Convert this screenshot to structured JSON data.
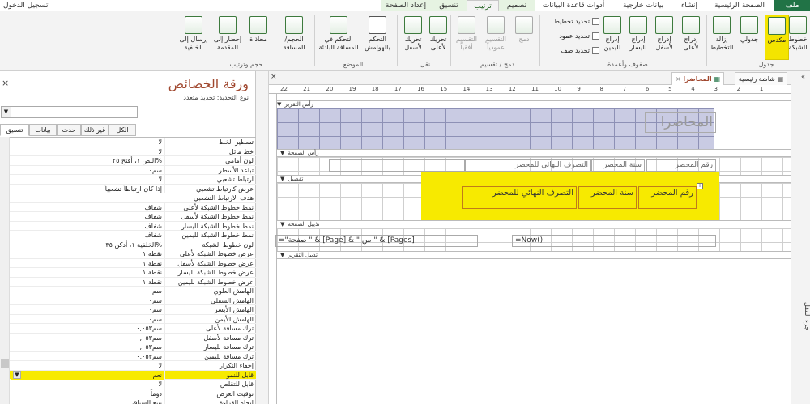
{
  "app": {
    "sign_in": "تسجيل الدخول"
  },
  "tabs": [
    {
      "label": "ملف",
      "kind": "file"
    },
    {
      "label": "الصفحة الرئيسية",
      "kind": "normal"
    },
    {
      "label": "إنشاء",
      "kind": "normal"
    },
    {
      "label": "بيانات خارجية",
      "kind": "normal"
    },
    {
      "label": "أدوات قاعدة البيانات",
      "kind": "normal"
    },
    {
      "label": "تصميم",
      "kind": "ctx"
    },
    {
      "label": "ترتيب",
      "kind": "active"
    },
    {
      "label": "تنسيق",
      "kind": "ctx"
    },
    {
      "label": "إعداد الصفحة",
      "kind": "ctx"
    }
  ],
  "ribbon": {
    "buttons": {
      "gridlines": "خطوط الشبكة",
      "stacked": "مكدس",
      "tabular": "جدولي",
      "remove_layout": "إزالة التخطيط",
      "insert_above": "إدراج لأعلى",
      "insert_below": "إدراج لأسفل",
      "insert_left": "إدراج لليسار",
      "insert_right": "إدراج لليمين",
      "merge": "دمج",
      "split_vertical": "التقسيم عمودياً",
      "split_horizontal": "التقسيم أفقياً",
      "move_up": "تحريك لأعلى",
      "move_down": "تحريك لأسفل",
      "control_margins": "التحكم بالهوامش",
      "control_padding": "التحكم في المسافة البادئة",
      "size_space": "الحجم/ المسافة",
      "align": "محاذاة",
      "bring_front": "إحضار إلى المقدمة",
      "send_back": "إرسال إلى الخلفية"
    },
    "small": {
      "select_layout": "تحديد تخطيط",
      "select_column": "تحديد عمود",
      "select_row": "تحديد صف"
    },
    "groups": {
      "table": "جدول",
      "rows_columns": "صفوف وأعمدة",
      "merge_split": "دمج / تقسيم",
      "move": "نقل",
      "position": "الموضع",
      "sizing_ordering": "حجم وترتيب"
    }
  },
  "properties": {
    "title": "ورقة الخصائص",
    "selection_type": "نوع التحديد:  تحديد متعدد",
    "close": "×",
    "tabs": [
      "الكل",
      "غير ذلك",
      "حدث",
      "بيانات",
      "تنسيق"
    ],
    "rows": [
      {
        "name": "تسطير الخط",
        "value": "لا"
      },
      {
        "name": "خط مائل",
        "value": "لا"
      },
      {
        "name": "لون أمامي",
        "value": "النص ۱، أفتح ۲٥%"
      },
      {
        "name": "تباعد الأسطر",
        "value": "۰سم"
      },
      {
        "name": "ارتباط تشعبي",
        "value": "لا"
      },
      {
        "name": "عرض كارتباط تشعبي",
        "value": "إذا كان ارتباطاً تشعبياً"
      },
      {
        "name": "هدف الارتباط التشعبي",
        "value": ""
      },
      {
        "name": "نمط خطوط الشبكة لأعلى",
        "value": "شفاف"
      },
      {
        "name": "نمط خطوط الشبكة لأسفل",
        "value": "شفاف"
      },
      {
        "name": "نمط خطوط الشبكة لليسار",
        "value": "شفاف"
      },
      {
        "name": "نمط خطوط الشبكة لليمين",
        "value": "شفاف"
      },
      {
        "name": "لون خطوط الشبكة",
        "value": "الخلفية ۱، أدكن ۳٥%"
      },
      {
        "name": "عرض خطوط الشبكة لأعلى",
        "value": "۱ نقطة"
      },
      {
        "name": "عرض خطوط الشبكة لأسفل",
        "value": "۱ نقطة"
      },
      {
        "name": "عرض خطوط الشبكة لليسار",
        "value": "۱ نقطة"
      },
      {
        "name": "عرض خطوط الشبكة لليمين",
        "value": "۱ نقطة"
      },
      {
        "name": "الهامش العلوي",
        "value": "۰سم"
      },
      {
        "name": "الهامش السفلي",
        "value": "۰سم"
      },
      {
        "name": "الهامش الأيسر",
        "value": "۰سم"
      },
      {
        "name": "الهامش الأيمن",
        "value": "۰سم"
      },
      {
        "name": "ترك مسافة لأعلى",
        "value": "۰,۰٥۳سم"
      },
      {
        "name": "ترك مسافة لأسفل",
        "value": "۰,۰٥۳سم"
      },
      {
        "name": "ترك مسافة لليسار",
        "value": "۰,۰٥۳سم"
      },
      {
        "name": "ترك مسافة لليمين",
        "value": "۰,۰٥۳سم"
      },
      {
        "name": "إخفاء التكرار",
        "value": "لا"
      },
      {
        "name": "قابل للنمو",
        "value": "نعم"
      },
      {
        "name": "قابل للتقلص",
        "value": "لا"
      },
      {
        "name": "توقيت العرض",
        "value": "دوماً"
      },
      {
        "name": "اتجاه القراءة",
        "value": "تتبع السياق"
      }
    ],
    "highlight_row": 25
  },
  "document": {
    "tabs": [
      {
        "label": "شاشة رئيسية",
        "active": false
      },
      {
        "label": "المحاضرا",
        "active": true
      }
    ],
    "ruler_numbers": [
      "22",
      "21",
      "20",
      "19",
      "18",
      "17",
      "16",
      "15",
      "14",
      "13",
      "12",
      "11",
      "10",
      "9",
      "8",
      "7",
      "6",
      "5",
      "4",
      "3",
      "2",
      "1"
    ],
    "sections": {
      "report_header": "رأس التقرير",
      "page_header": "رأس الصفحة",
      "detail": "تفصيل",
      "page_footer": "تذييل الصفحة",
      "report_footer": "تذييل التقرير"
    },
    "report_title": "المحاضرا",
    "page_header_labels": [
      "رقم المحضر",
      "سنة المحضر",
      "التصرف النهائي للمحضر"
    ],
    "detail_fields": [
      "رقم المحضر",
      "سنة المحضر",
      "التصرف النهائي للمحضر"
    ],
    "footer_pages": "=\"صفحة \" & [Page] & \" من \" & [Pages]",
    "footer_now": "=Now()"
  },
  "nav_pane": {
    "label": "جزء التنقل"
  },
  "colors": {
    "highlight": "#f7ea00",
    "accent": "#217346",
    "title": "#a0472e"
  }
}
